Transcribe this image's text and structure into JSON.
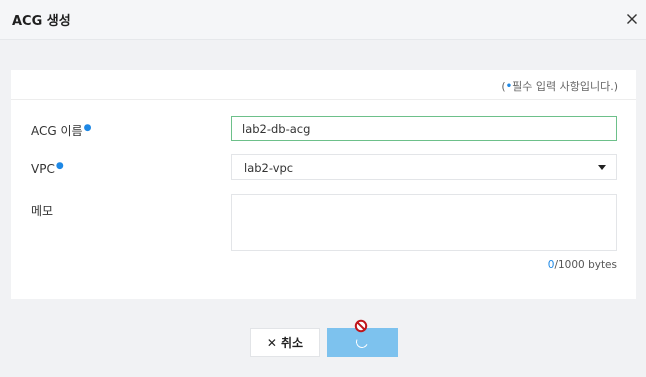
{
  "dialog": {
    "title": "ACG 생성"
  },
  "form": {
    "required_note_prefix": "(",
    "required_note_dot": "•",
    "required_note_text": "필수 입력 사항입니다.)",
    "acg_name_label": "ACG 이름",
    "acg_name_value": "lab2-db-acg",
    "vpc_label": "VPC",
    "vpc_value": "lab2-vpc",
    "memo_label": "메모",
    "memo_value": "",
    "bytes_current": "0",
    "bytes_max": "/1000 bytes"
  },
  "buttons": {
    "cancel_label": "취소",
    "create_state": "loading"
  },
  "colors": {
    "required_dot": "#1e88e5",
    "focused_border": "#6dc08a",
    "create_button": "#7dc2ee"
  },
  "icons": {
    "close": "close-icon",
    "cancel": "x-icon",
    "dropdown": "caret-down-icon",
    "spinner": "loading-spinner-icon",
    "cursor": "not-allowed-cursor-icon"
  }
}
